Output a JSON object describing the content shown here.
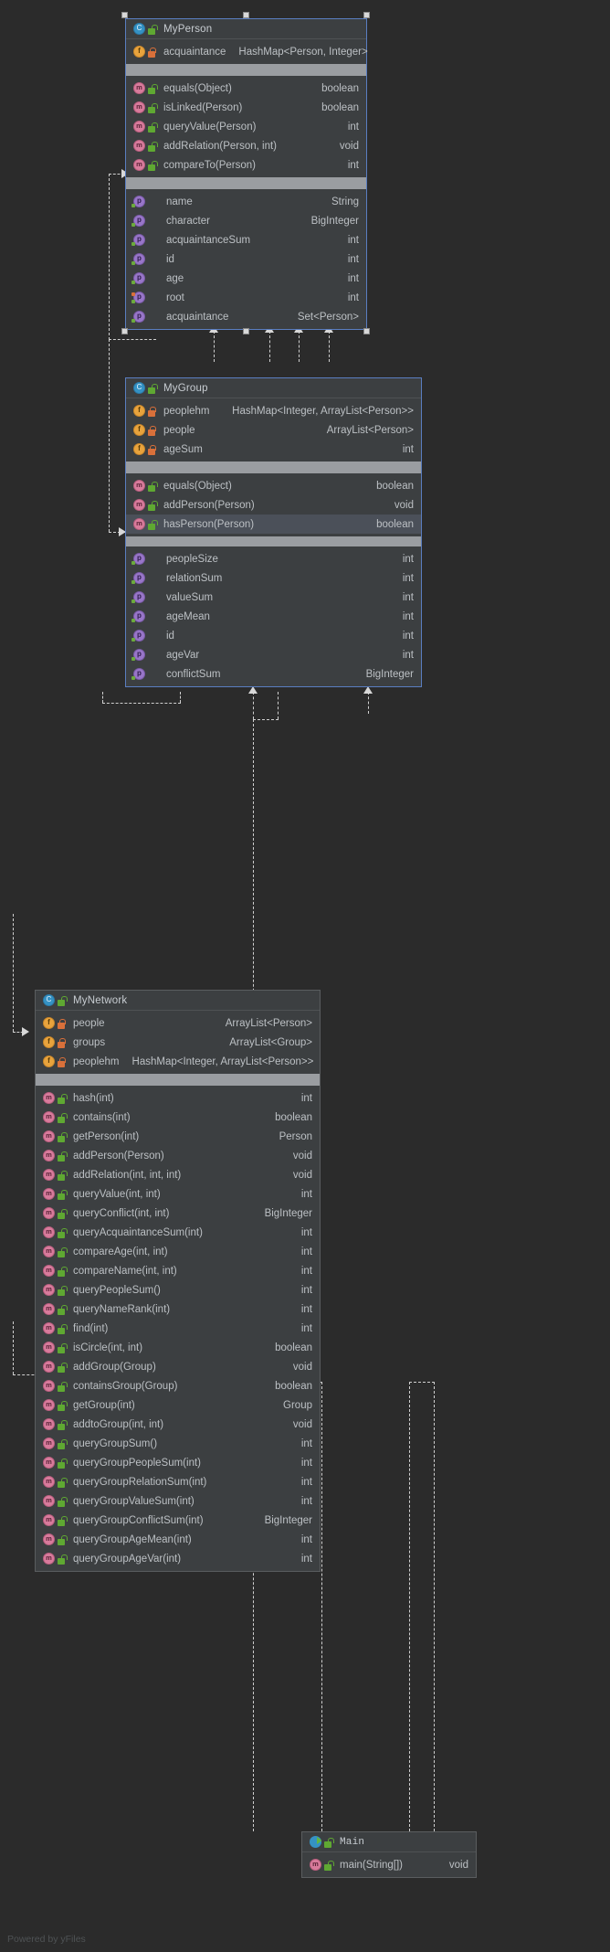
{
  "diagram": {
    "watermark": "Powered by yFiles",
    "background_color": "#2b2b2b",
    "selection_color": "#5a7ec1"
  },
  "classes": [
    {
      "name": "MyPerson",
      "icon": "class-icon",
      "visibility_icon": "public-lock-icon",
      "selected": true,
      "fields": [
        {
          "name": "acquaintance",
          "type": "HashMap<Person, Integer>",
          "icon": "field-icon",
          "visibility_icon": "private-lock-icon"
        }
      ],
      "methods": [
        {
          "name": "equals(Object)",
          "type": "boolean",
          "icon": "method-icon",
          "visibility_icon": "public-lock-icon"
        },
        {
          "name": "isLinked(Person)",
          "type": "boolean",
          "icon": "method-icon",
          "visibility_icon": "public-lock-icon"
        },
        {
          "name": "queryValue(Person)",
          "type": "int",
          "icon": "method-icon",
          "visibility_icon": "public-lock-icon"
        },
        {
          "name": "addRelation(Person, int)",
          "type": "void",
          "icon": "method-icon",
          "visibility_icon": "public-lock-icon"
        },
        {
          "name": "compareTo(Person)",
          "type": "int",
          "icon": "method-icon",
          "visibility_icon": "public-lock-icon"
        }
      ],
      "properties": [
        {
          "name": "name",
          "type": "String",
          "icon": "property-icon",
          "badges": [
            "getter"
          ]
        },
        {
          "name": "character",
          "type": "BigInteger",
          "icon": "property-icon",
          "badges": [
            "getter"
          ]
        },
        {
          "name": "acquaintanceSum",
          "type": "int",
          "icon": "property-icon",
          "badges": [
            "getter"
          ]
        },
        {
          "name": "id",
          "type": "int",
          "icon": "property-icon",
          "badges": [
            "getter"
          ]
        },
        {
          "name": "age",
          "type": "int",
          "icon": "property-icon",
          "badges": [
            "getter"
          ]
        },
        {
          "name": "root",
          "type": "int",
          "icon": "property-icon",
          "badges": [
            "getter",
            "setter"
          ]
        },
        {
          "name": "acquaintance",
          "type": "Set<Person>",
          "icon": "property-icon",
          "badges": [
            "getter"
          ]
        }
      ]
    },
    {
      "name": "MyGroup",
      "icon": "class-icon",
      "visibility_icon": "public-lock-icon",
      "selected": true,
      "fields": [
        {
          "name": "peoplehm",
          "type": "HashMap<Integer, ArrayList<Person>>",
          "icon": "field-icon",
          "visibility_icon": "private-lock-icon"
        },
        {
          "name": "people",
          "type": "ArrayList<Person>",
          "icon": "field-icon",
          "visibility_icon": "private-lock-icon"
        },
        {
          "name": "ageSum",
          "type": "int",
          "icon": "field-icon",
          "visibility_icon": "private-lock-icon"
        }
      ],
      "methods": [
        {
          "name": "equals(Object)",
          "type": "boolean",
          "icon": "method-icon",
          "visibility_icon": "public-lock-icon"
        },
        {
          "name": "addPerson(Person)",
          "type": "void",
          "icon": "method-icon",
          "visibility_icon": "public-lock-icon"
        },
        {
          "name": "hasPerson(Person)",
          "type": "boolean",
          "icon": "method-icon",
          "visibility_icon": "public-lock-icon",
          "highlighted": true
        }
      ],
      "properties": [
        {
          "name": "peopleSize",
          "type": "int",
          "icon": "property-icon",
          "badges": [
            "getter"
          ]
        },
        {
          "name": "relationSum",
          "type": "int",
          "icon": "property-icon",
          "badges": [
            "getter"
          ]
        },
        {
          "name": "valueSum",
          "type": "int",
          "icon": "property-icon",
          "badges": [
            "getter"
          ]
        },
        {
          "name": "ageMean",
          "type": "int",
          "icon": "property-icon",
          "badges": [
            "getter"
          ]
        },
        {
          "name": "id",
          "type": "int",
          "icon": "property-icon",
          "badges": [
            "getter"
          ]
        },
        {
          "name": "ageVar",
          "type": "int",
          "icon": "property-icon",
          "badges": [
            "getter"
          ]
        },
        {
          "name": "conflictSum",
          "type": "BigInteger",
          "icon": "property-icon",
          "badges": [
            "getter"
          ]
        }
      ]
    },
    {
      "name": "MyNetwork",
      "icon": "class-icon",
      "visibility_icon": "public-lock-icon",
      "selected": false,
      "fields": [
        {
          "name": "people",
          "type": "ArrayList<Person>",
          "icon": "field-icon",
          "visibility_icon": "private-lock-icon"
        },
        {
          "name": "groups",
          "type": "ArrayList<Group>",
          "icon": "field-icon",
          "visibility_icon": "private-lock-icon"
        },
        {
          "name": "peoplehm",
          "type": "HashMap<Integer, ArrayList<Person>>",
          "icon": "field-icon",
          "visibility_icon": "private-lock-icon"
        }
      ],
      "methods": [
        {
          "name": "hash(int)",
          "type": "int",
          "icon": "method-icon",
          "visibility_icon": "public-lock-icon"
        },
        {
          "name": "contains(int)",
          "type": "boolean",
          "icon": "method-icon",
          "visibility_icon": "public-lock-icon"
        },
        {
          "name": "getPerson(int)",
          "type": "Person",
          "icon": "method-icon",
          "visibility_icon": "public-lock-icon"
        },
        {
          "name": "addPerson(Person)",
          "type": "void",
          "icon": "method-icon",
          "visibility_icon": "public-lock-icon"
        },
        {
          "name": "addRelation(int, int, int)",
          "type": "void",
          "icon": "method-icon",
          "visibility_icon": "public-lock-icon"
        },
        {
          "name": "queryValue(int, int)",
          "type": "int",
          "icon": "method-icon",
          "visibility_icon": "public-lock-icon"
        },
        {
          "name": "queryConflict(int, int)",
          "type": "BigInteger",
          "icon": "method-icon",
          "visibility_icon": "public-lock-icon"
        },
        {
          "name": "queryAcquaintanceSum(int)",
          "type": "int",
          "icon": "method-icon",
          "visibility_icon": "public-lock-icon"
        },
        {
          "name": "compareAge(int, int)",
          "type": "int",
          "icon": "method-icon",
          "visibility_icon": "public-lock-icon"
        },
        {
          "name": "compareName(int, int)",
          "type": "int",
          "icon": "method-icon",
          "visibility_icon": "public-lock-icon"
        },
        {
          "name": "queryPeopleSum()",
          "type": "int",
          "icon": "method-icon",
          "visibility_icon": "public-lock-icon"
        },
        {
          "name": "queryNameRank(int)",
          "type": "int",
          "icon": "method-icon",
          "visibility_icon": "public-lock-icon"
        },
        {
          "name": "find(int)",
          "type": "int",
          "icon": "method-icon",
          "visibility_icon": "public-lock-icon"
        },
        {
          "name": "isCircle(int, int)",
          "type": "boolean",
          "icon": "method-icon",
          "visibility_icon": "public-lock-icon"
        },
        {
          "name": "addGroup(Group)",
          "type": "void",
          "icon": "method-icon",
          "visibility_icon": "public-lock-icon"
        },
        {
          "name": "containsGroup(Group)",
          "type": "boolean",
          "icon": "method-icon",
          "visibility_icon": "public-lock-icon"
        },
        {
          "name": "getGroup(int)",
          "type": "Group",
          "icon": "method-icon",
          "visibility_icon": "public-lock-icon"
        },
        {
          "name": "addtoGroup(int, int)",
          "type": "void",
          "icon": "method-icon",
          "visibility_icon": "public-lock-icon"
        },
        {
          "name": "queryGroupSum()",
          "type": "int",
          "icon": "method-icon",
          "visibility_icon": "public-lock-icon"
        },
        {
          "name": "queryGroupPeopleSum(int)",
          "type": "int",
          "icon": "method-icon",
          "visibility_icon": "public-lock-icon"
        },
        {
          "name": "queryGroupRelationSum(int)",
          "type": "int",
          "icon": "method-icon",
          "visibility_icon": "public-lock-icon"
        },
        {
          "name": "queryGroupValueSum(int)",
          "type": "int",
          "icon": "method-icon",
          "visibility_icon": "public-lock-icon"
        },
        {
          "name": "queryGroupConflictSum(int)",
          "type": "BigInteger",
          "icon": "method-icon",
          "visibility_icon": "public-lock-icon"
        },
        {
          "name": "queryGroupAgeMean(int)",
          "type": "int",
          "icon": "method-icon",
          "visibility_icon": "public-lock-icon"
        },
        {
          "name": "queryGroupAgeVar(int)",
          "type": "int",
          "icon": "method-icon",
          "visibility_icon": "public-lock-icon"
        }
      ],
      "properties": []
    },
    {
      "name": "Main",
      "icon": "runnable-class-icon",
      "visibility_icon": "public-lock-icon",
      "selected": false,
      "fields": [],
      "methods": [
        {
          "name": "main(String[])",
          "type": "void",
          "icon": "method-icon",
          "visibility_icon": "public-lock-icon"
        }
      ],
      "properties": []
    }
  ]
}
